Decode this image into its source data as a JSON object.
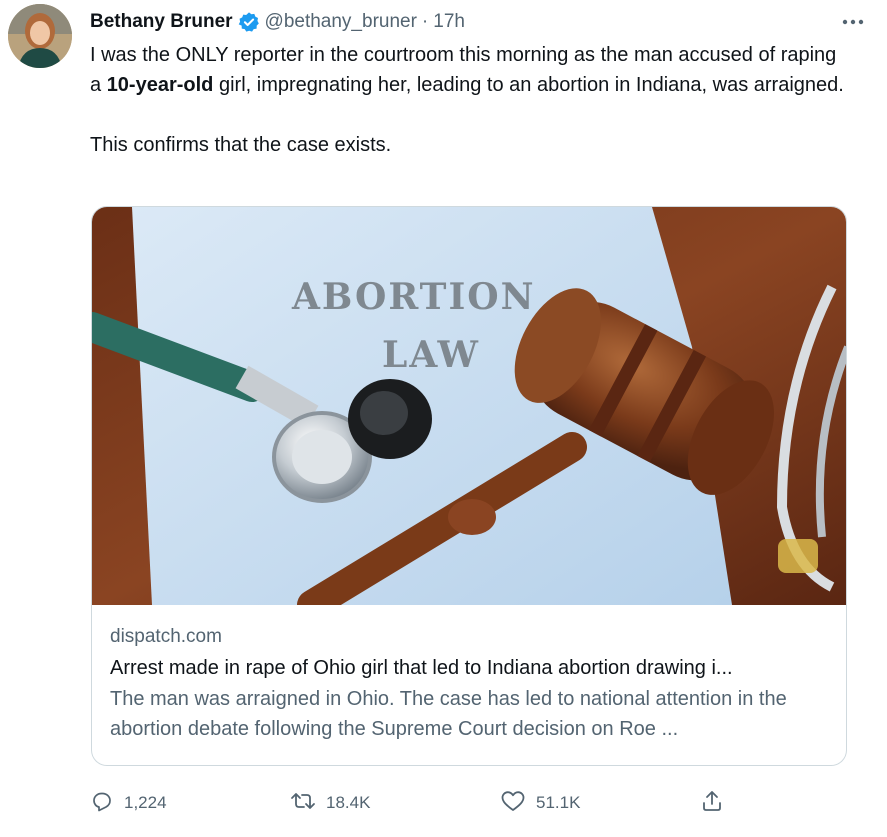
{
  "author": {
    "display_name": "Bethany Bruner",
    "handle": "@bethany_bruner",
    "separator": "·",
    "time": "17h",
    "verified_icon": "verified-badge-icon",
    "verified_color": "#1d9bf0"
  },
  "tweet": {
    "line1": "I was the ONLY reporter in the courtroom this morning as the man accused of raping a ",
    "bold": "10-year-old",
    "line1_end": " girl, impregnating her, leading to an abortion in Indiana, was arraigned.",
    "line2": "This confirms that the case exists."
  },
  "card": {
    "image_text_1": "ABORTION",
    "image_text_2": "LAW",
    "domain": "dispatch.com",
    "title": "Arrest made in rape of Ohio girl that led to Indiana abortion drawing i...",
    "description": "The man was arraigned in Ohio. The case has led to national attention in the abortion debate following the Supreme Court decision on Roe ..."
  },
  "actions": {
    "replies": "1,224",
    "retweets": "18.4K",
    "likes": "51.1K",
    "reply_icon": "reply-icon",
    "retweet_icon": "retweet-icon",
    "like_icon": "heart-icon",
    "share_icon": "share-icon"
  },
  "colors": {
    "text": "#0f1419",
    "secondary": "#536471",
    "accent": "#1d9bf0",
    "border": "#cfd9de"
  }
}
